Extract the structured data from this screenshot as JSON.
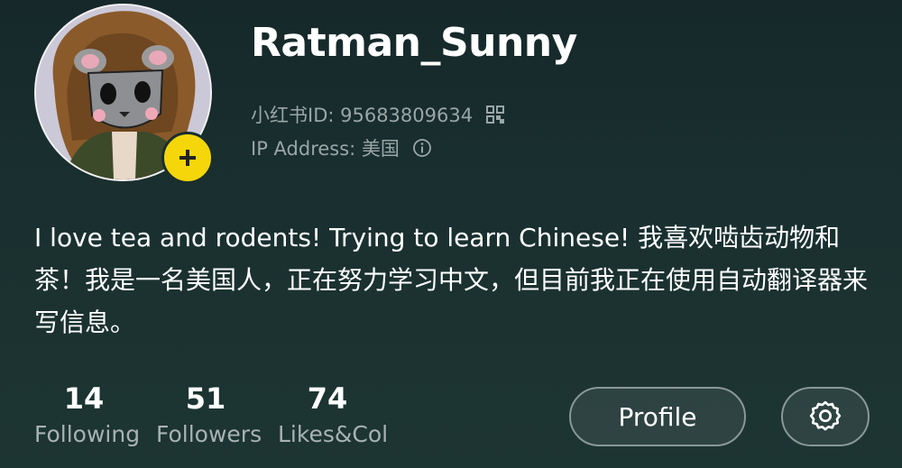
{
  "profile": {
    "username": "Ratman_Sunny",
    "id_text": "小红书ID: 95683809634",
    "ip_text": "IP Address: 美国",
    "bio": "I love tea and rodents! Trying to learn Chinese! 我喜欢啮齿动物和茶！我是一名美国人，正在努力学习中文，但目前我正在使用自动翻译器来写信息。"
  },
  "stats": [
    {
      "value": "14",
      "label": "Following"
    },
    {
      "value": "51",
      "label": "Followers"
    },
    {
      "value": "74",
      "label": "Likes&Col"
    }
  ],
  "buttons": {
    "profile_label": "Profile"
  },
  "colors": {
    "accent_badge": "#f5d60a",
    "muted_text": "#9aa6a6"
  },
  "icons": [
    "add-icon",
    "qr-code-icon",
    "info-icon",
    "gear-icon"
  ]
}
